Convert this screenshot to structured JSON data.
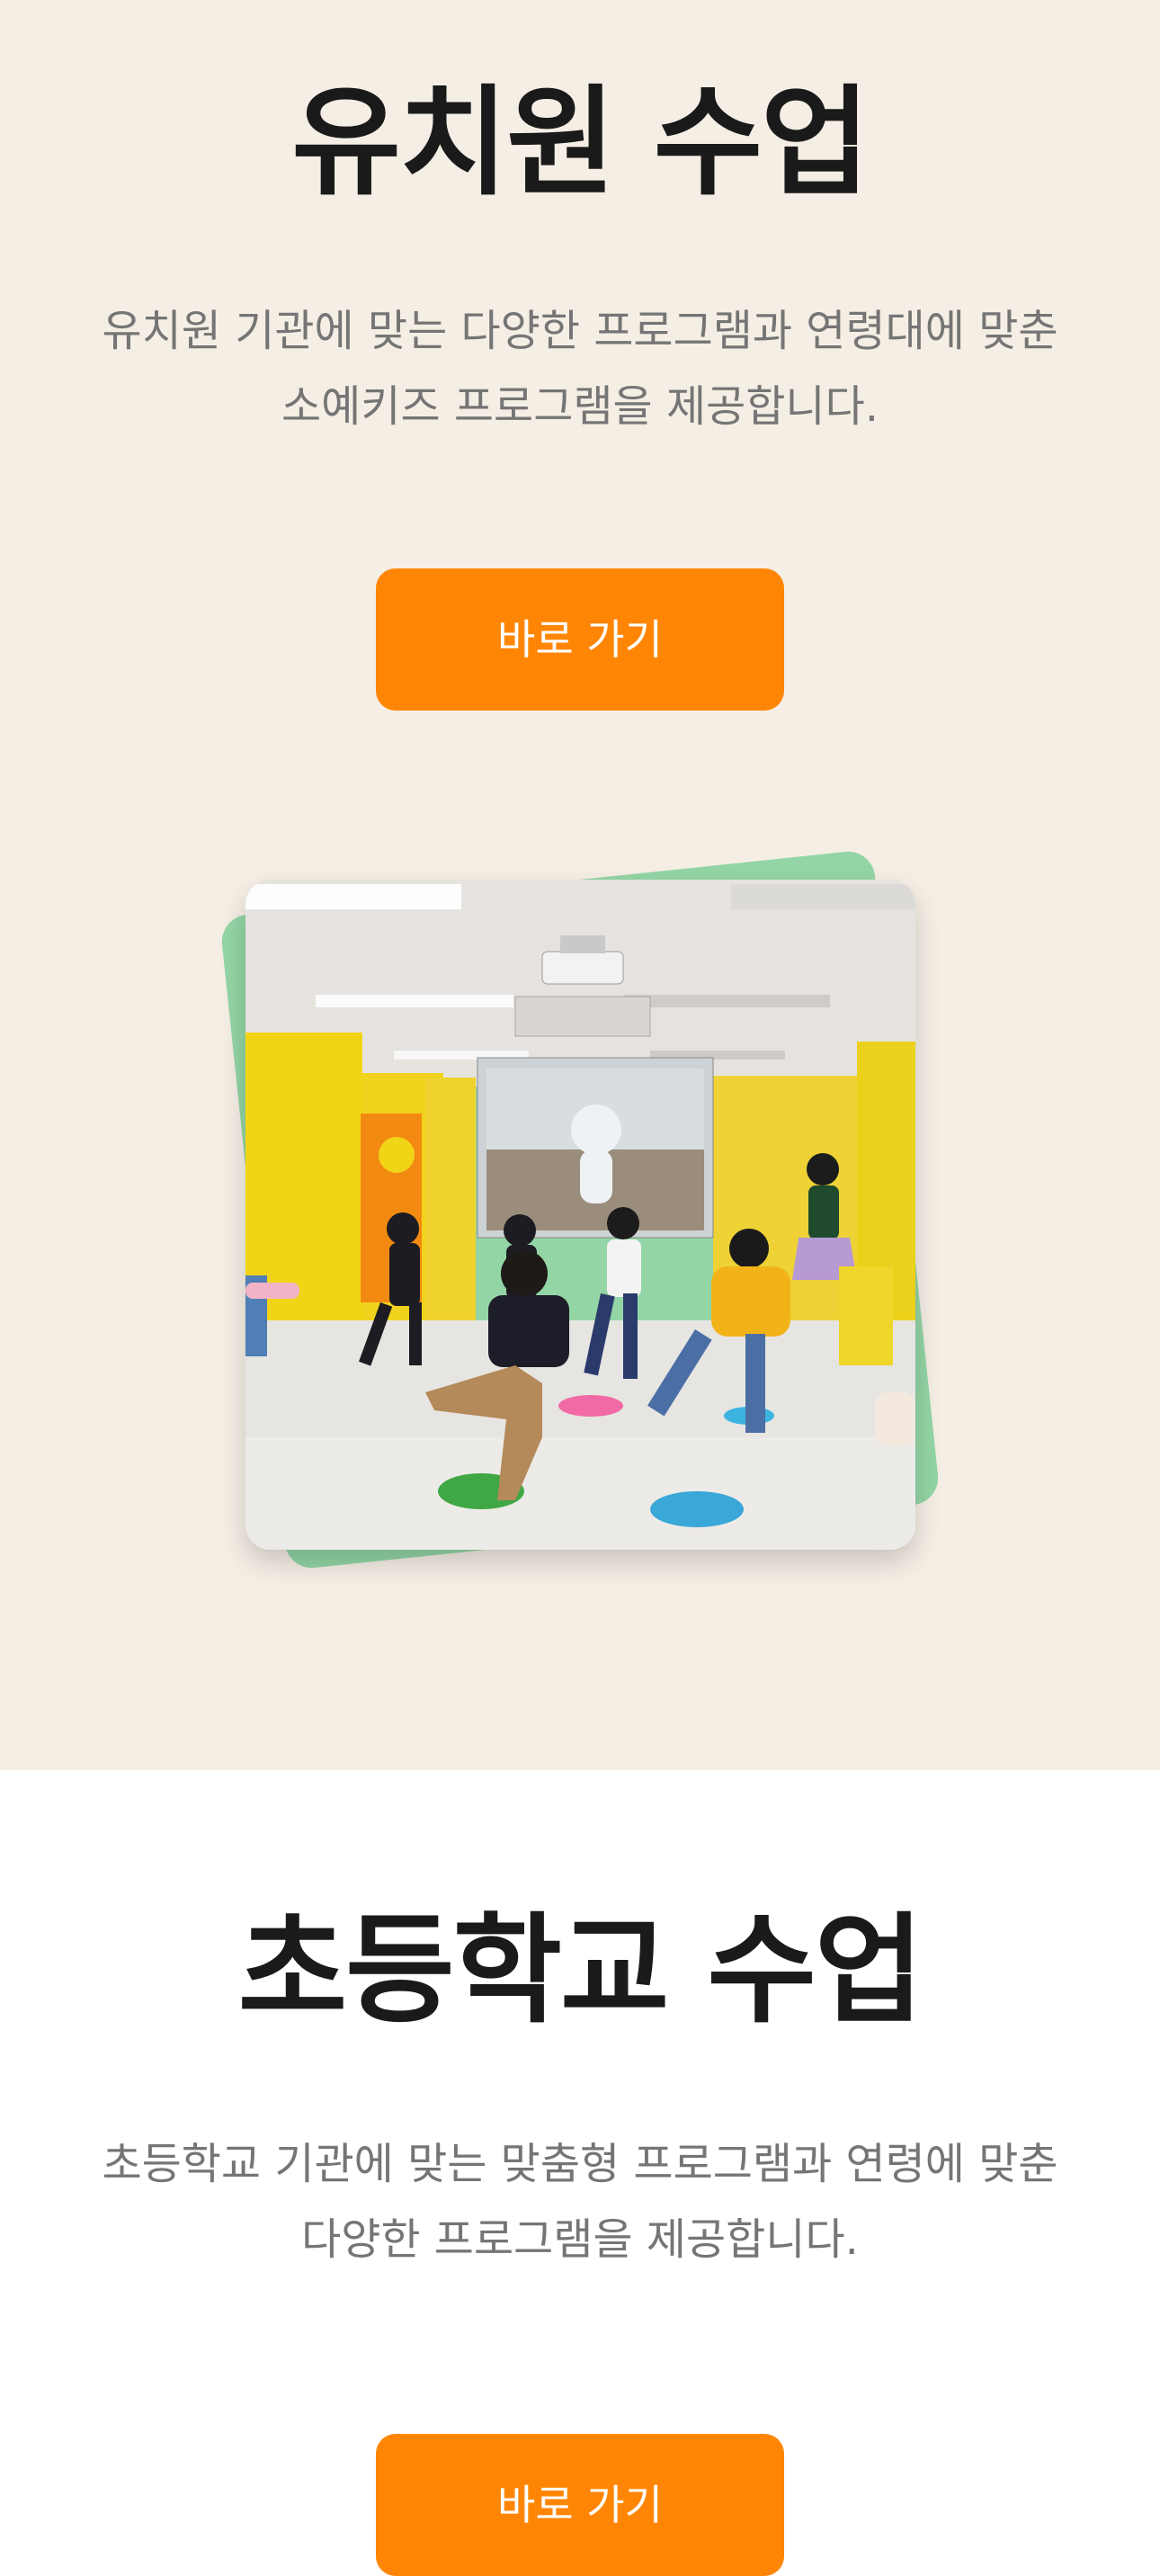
{
  "kindergarten": {
    "title": "유치원 수업",
    "description_line1": "유치원 기관에 맞는 다양한 프로그램과 연령대에 맞춘",
    "description_line2": "소예키즈 프로그램을 제공합니다.",
    "button_label": "바로 가기",
    "photo_alt": "children dancing in classroom photo"
  },
  "elementary": {
    "title": "초등학교 수업",
    "description_line1": "초등학교 기관에 맞는 맞춤형 프로그램과 연령에 맞춘",
    "description_line2": "다양한 프로그램을 제공합니다.",
    "button_label": "바로 가기"
  },
  "colors": {
    "accent": "#ff8604",
    "section_bg": "#f5eee5",
    "photo_backdrop": "#93d5a5",
    "title_text": "#1a1a1a",
    "body_text": "#757575"
  }
}
